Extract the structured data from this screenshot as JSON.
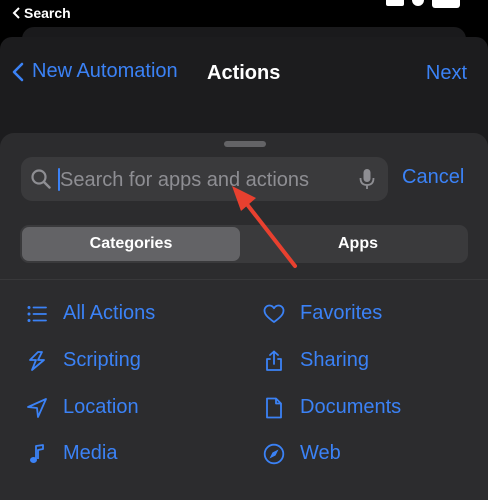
{
  "status_bar": {
    "back_label": "Search"
  },
  "nav": {
    "back_label": "New Automation",
    "title": "Actions",
    "next_label": "Next"
  },
  "search": {
    "placeholder": "Search for apps and actions",
    "cancel_label": "Cancel"
  },
  "segments": [
    {
      "label": "Categories",
      "selected": true
    },
    {
      "label": "Apps",
      "selected": false
    }
  ],
  "categories": [
    {
      "label": "All Actions",
      "icon": "list-icon"
    },
    {
      "label": "Favorites",
      "icon": "heart-icon"
    },
    {
      "label": "Scripting",
      "icon": "scripting-icon"
    },
    {
      "label": "Sharing",
      "icon": "share-icon"
    },
    {
      "label": "Location",
      "icon": "location-arrow-icon"
    },
    {
      "label": "Documents",
      "icon": "document-icon"
    },
    {
      "label": "Media",
      "icon": "music-note-icon"
    },
    {
      "label": "Web",
      "icon": "compass-icon"
    }
  ],
  "colors": {
    "accent": "#3b82f6",
    "annotation": "#e8402f",
    "sheet": "#2c2c2e",
    "field": "#3a3a3c"
  }
}
